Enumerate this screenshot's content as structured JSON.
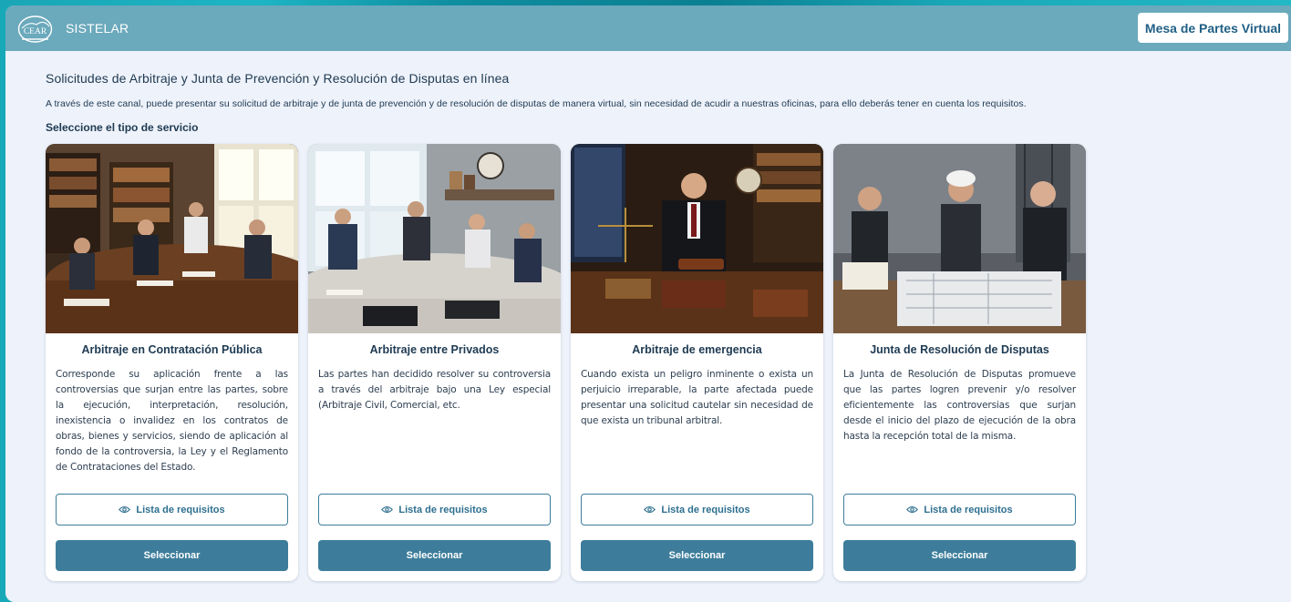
{
  "header": {
    "logo_text": "CEAR",
    "brand": "SISTELAR",
    "mesa_button": "Mesa de Partes Virtual"
  },
  "page": {
    "title": "Solicitudes de Arbitraje y Junta de Prevención y Resolución de Disputas en línea",
    "description": "A través de este canal, puede presentar su solicitud de arbitraje y de junta de prevención y de resolución de disputas de manera virtual, sin necesidad de acudir a nuestras oficinas, para ello deberás tener en cuenta los requisitos.",
    "section_title": "Seleccione el tipo de servicio"
  },
  "cards": [
    {
      "title": "Arbitraje en Contratación Pública",
      "text": "Corresponde su aplicación frente a las controversias que surjan entre las partes, sobre la ejecución, interpretación, resolución, inexistencia o invalidez en los contratos de obras, bienes y servicios, siendo de aplicación al fondo de la controversia, la Ley y el Reglamento de Contrataciones del Estado.",
      "requirements_label": "Lista de requisitos",
      "select_label": "Seleccionar"
    },
    {
      "title": "Arbitraje entre Privados",
      "text": "Las partes han decidido resolver su controversia a través del arbitraje bajo una Ley especial (Arbitraje Civil, Comercial, etc.",
      "requirements_label": "Lista de requisitos",
      "select_label": "Seleccionar"
    },
    {
      "title": "Arbitraje de emergencia",
      "text": "Cuando exista un peligro inminente o exista un perjuicio irreparable, la parte afectada puede presentar una solicitud cautelar sin necesidad de que exista un tribunal arbitral.",
      "requirements_label": "Lista de requisitos",
      "select_label": "Seleccionar"
    },
    {
      "title": "Junta de Resolución de Disputas",
      "text": "La Junta de Resolución de Disputas promueve que las partes logren prevenir y/o resolver eficientemente las controversias que surjan desde el inicio del plazo de ejecución de la obra hasta la recepción total de la misma.",
      "requirements_label": "Lista de requisitos",
      "select_label": "Seleccionar"
    }
  ],
  "colors": {
    "header": "#6ba9bc",
    "primary": "#3d7d9b",
    "background": "#eef2fa",
    "outer": "#17a9b7",
    "text": "#1e3a52"
  },
  "icons": {
    "requirements": "eye-icon",
    "logo": "cear-logo"
  }
}
